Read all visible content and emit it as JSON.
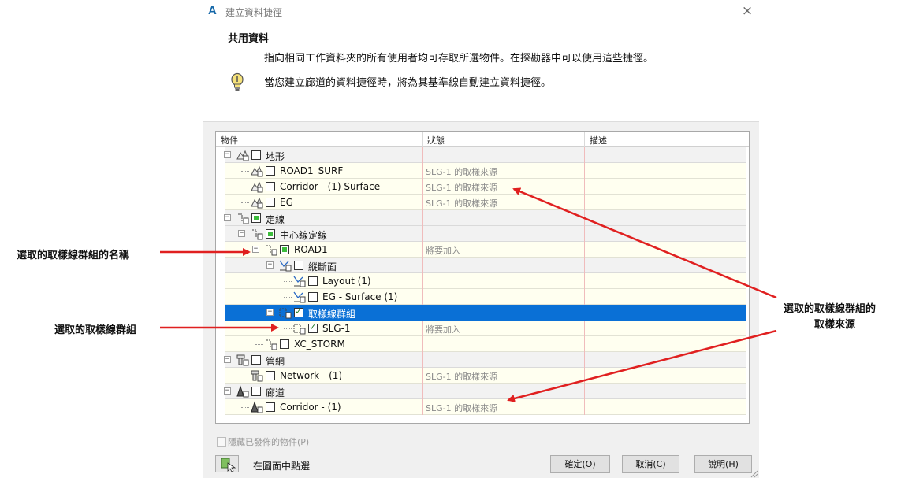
{
  "window": {
    "title": "建立資料捷徑",
    "close_glyph": "×"
  },
  "header": {
    "title": "共用資料",
    "description": "指向相同工作資料夾的所有使用者均可存取所選物件。在探勘器中可以使用這些捷徑。",
    "tip": "當您建立廊道的資料捷徑時，將為其基準線自動建立資料捷徑。"
  },
  "columns": [
    "物件",
    "狀態",
    "描述"
  ],
  "tree": [
    {
      "label": "地形",
      "state": "",
      "level": 0,
      "kind": "category",
      "check": "none",
      "icon": "surface-icon",
      "expander": "⊟"
    },
    {
      "label": "ROAD1_SURF",
      "state": "SLG-1 的取樣來源",
      "level": 1,
      "kind": "item",
      "check": "none",
      "icon": "surface-icon"
    },
    {
      "label": "Corridor - (1) Surface",
      "state": "SLG-1 的取樣來源",
      "level": 1,
      "kind": "item",
      "check": "none",
      "icon": "surface-icon"
    },
    {
      "label": "EG",
      "state": "SLG-1 的取樣來源",
      "level": 1,
      "kind": "item",
      "check": "none",
      "icon": "surface-icon"
    },
    {
      "label": "定線",
      "state": "",
      "level": 0,
      "kind": "category",
      "check": "partial",
      "icon": "alignment-icon",
      "expander": "⊟"
    },
    {
      "label": "中心線定線",
      "state": "",
      "level": 1,
      "kind": "category",
      "check": "partial",
      "icon": "alignment-icon",
      "expander": "⊟"
    },
    {
      "label": "ROAD1",
      "state": "將要加入",
      "level": 2,
      "kind": "item",
      "check": "partial",
      "icon": "alignment-icon",
      "expander": "⊟"
    },
    {
      "label": "縱斷面",
      "state": "",
      "level": 3,
      "kind": "category",
      "check": "none",
      "icon": "profile-icon",
      "expander": "⊟"
    },
    {
      "label": "Layout (1)",
      "state": "",
      "level": 4,
      "kind": "item",
      "check": "none",
      "icon": "profile-icon"
    },
    {
      "label": "EG - Surface (1)",
      "state": "",
      "level": 4,
      "kind": "item",
      "check": "none",
      "icon": "profile-icon"
    },
    {
      "label": "取樣線群組",
      "state": "",
      "level": 3,
      "kind": "selected",
      "check": "checked",
      "icon": "sample-line-group-icon",
      "expander": "⊟"
    },
    {
      "label": "SLG-1",
      "state": "將要加入",
      "level": 4,
      "kind": "item",
      "check": "checked",
      "icon": "sample-line-group-icon"
    },
    {
      "label": "XC_STORM",
      "state": "",
      "level": 2,
      "kind": "item",
      "check": "none",
      "icon": "alignment-icon"
    },
    {
      "label": "管網",
      "state": "",
      "level": 0,
      "kind": "category",
      "check": "none",
      "icon": "pipe-network-icon",
      "expander": "⊟"
    },
    {
      "label": "Network - (1)",
      "state": "SLG-1 的取樣來源",
      "level": 1,
      "kind": "item",
      "check": "none",
      "icon": "pipe-network-icon"
    },
    {
      "label": "廊道",
      "state": "",
      "level": 0,
      "kind": "category",
      "check": "none",
      "icon": "corridor-icon",
      "expander": "⊟"
    },
    {
      "label": "Corridor - (1)",
      "state": "SLG-1 的取樣來源",
      "level": 1,
      "kind": "item",
      "check": "none",
      "icon": "corridor-icon"
    }
  ],
  "footer": {
    "hide_published_label": "隱藏已發佈的物件(P)",
    "pick_label": "在圖面中點選",
    "ok_label": "確定(O)",
    "cancel_label": "取消(C)",
    "help_label": "說明(H)"
  },
  "annotations": {
    "group_name": "選取的取樣線群組的名稱",
    "group": "選取的取樣線群組",
    "source_line1": "選取的取樣線群組的",
    "source_line2": "取樣來源"
  },
  "colors": {
    "selection": "#0a70d6",
    "row_bg": "#fffff0",
    "category_bg": "#f2f2f2",
    "arrow": "#e02020",
    "check_partial": "#3cbc3c"
  }
}
